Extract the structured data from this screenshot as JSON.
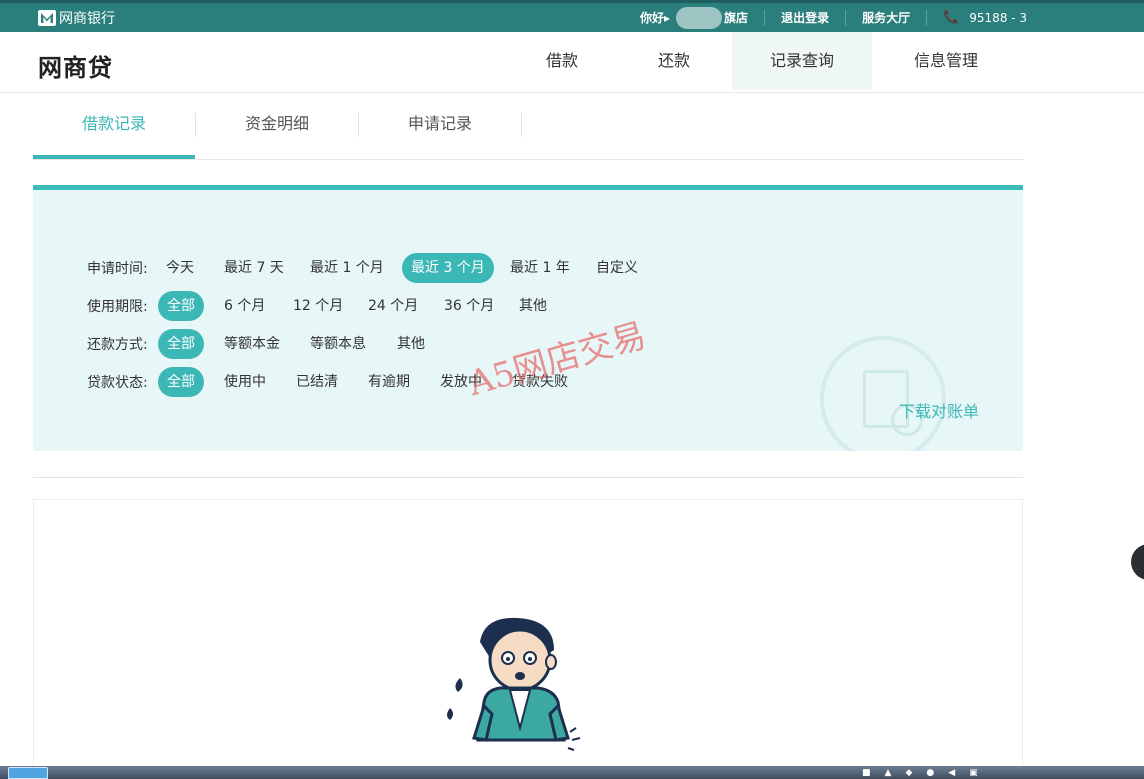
{
  "topbar": {
    "bank_name": "网商银行",
    "greeting": "你好",
    "greeting_arrow": "▸",
    "shop_suffix": "旗店",
    "logout": "退出登录",
    "service_hall": "服务大厅",
    "phone": "95188 - 3"
  },
  "header": {
    "brand": "网商贷",
    "nav": [
      "借款",
      "还款",
      "记录查询",
      "信息管理"
    ],
    "active_nav": "记录查询"
  },
  "subtabs": {
    "items": [
      "借款记录",
      "资金明细",
      "申请记录"
    ],
    "active": "借款记录"
  },
  "filters": {
    "apply_time": {
      "label": "申请时间:",
      "options": [
        "今天",
        "最近 7 天",
        "最近 1 个月",
        "最近 3 个月",
        "最近 1 年",
        "自定义"
      ],
      "selected": "最近 3 个月"
    },
    "term": {
      "label": "使用期限:",
      "options": [
        "全部",
        "6 个月",
        "12 个月",
        "24 个月",
        "36 个月",
        "其他"
      ],
      "selected": "全部"
    },
    "repay_method": {
      "label": "还款方式:",
      "options": [
        "全部",
        "等额本金",
        "等额本息",
        "其他"
      ],
      "selected": "全部"
    },
    "loan_status": {
      "label": "贷款状态:",
      "options": [
        "全部",
        "使用中",
        "已结清",
        "有逾期",
        "发放中",
        "贷款失败"
      ],
      "selected": "全部"
    },
    "download_statement": "下载对账单"
  },
  "watermark": "A5网店交易",
  "colors": {
    "topbar": "#2a7e7c",
    "accent": "#3bb8b6",
    "panel_bg": "#e7f6f6"
  }
}
